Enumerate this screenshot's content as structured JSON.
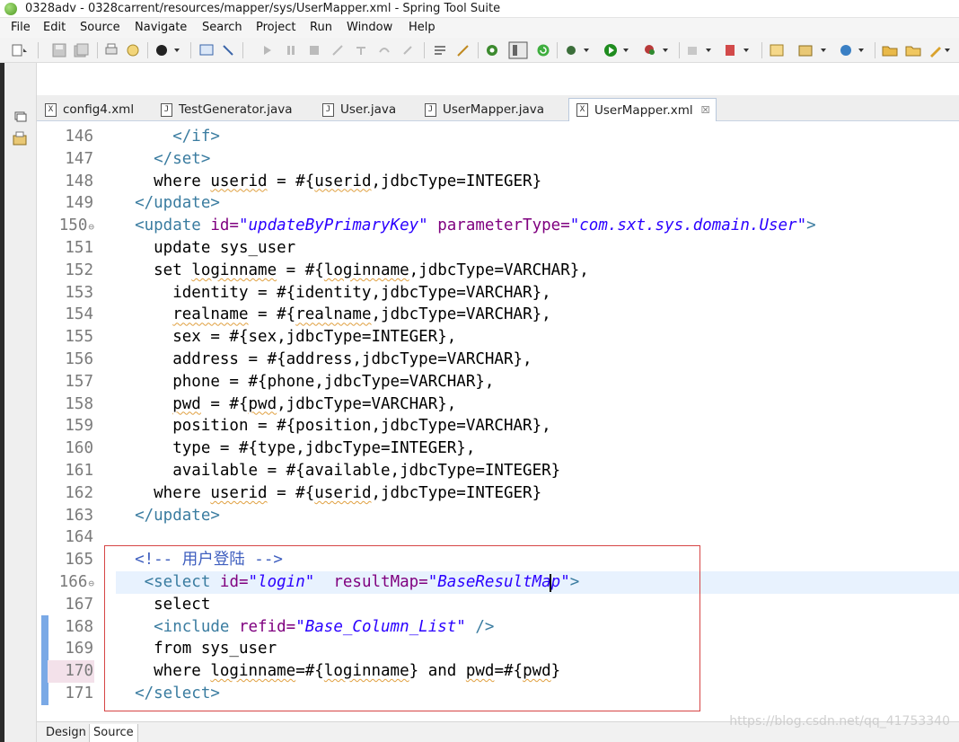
{
  "window": {
    "title": "0328adv - 0328carrent/resources/mapper/sys/UserMapper.xml - Spring Tool Suite"
  },
  "menu": [
    "File",
    "Edit",
    "Source",
    "Navigate",
    "Search",
    "Project",
    "Run",
    "Window",
    "Help"
  ],
  "tabs": [
    {
      "label": "config4.xml",
      "icon": "xml-file-icon",
      "active": false
    },
    {
      "label": "TestGenerator.java",
      "icon": "java-file-icon",
      "active": false
    },
    {
      "label": "User.java",
      "icon": "java-file-icon",
      "active": false
    },
    {
      "label": "UserMapper.java",
      "icon": "java-file-icon",
      "active": false
    },
    {
      "label": "UserMapper.xml",
      "icon": "xml-file-icon",
      "active": true,
      "close": "☒"
    }
  ],
  "editor": {
    "lines": [
      {
        "n": "146",
        "fold": ""
      },
      {
        "n": "147",
        "fold": ""
      },
      {
        "n": "148",
        "fold": ""
      },
      {
        "n": "149",
        "fold": ""
      },
      {
        "n": "150",
        "fold": "⊖"
      },
      {
        "n": "151",
        "fold": ""
      },
      {
        "n": "152",
        "fold": ""
      },
      {
        "n": "153",
        "fold": ""
      },
      {
        "n": "154",
        "fold": ""
      },
      {
        "n": "155",
        "fold": ""
      },
      {
        "n": "156",
        "fold": ""
      },
      {
        "n": "157",
        "fold": ""
      },
      {
        "n": "158",
        "fold": ""
      },
      {
        "n": "159",
        "fold": ""
      },
      {
        "n": "160",
        "fold": ""
      },
      {
        "n": "161",
        "fold": ""
      },
      {
        "n": "162",
        "fold": ""
      },
      {
        "n": "163",
        "fold": ""
      },
      {
        "n": "164",
        "fold": ""
      },
      {
        "n": "165",
        "fold": ""
      },
      {
        "n": "166",
        "fold": "⊖"
      },
      {
        "n": "167",
        "fold": ""
      },
      {
        "n": "168",
        "fold": ""
      },
      {
        "n": "169",
        "fold": ""
      },
      {
        "n": "170",
        "fold": ""
      },
      {
        "n": "171",
        "fold": ""
      }
    ],
    "code": {
      "l146": "      </if>",
      "l147": "    </set>",
      "l148a": "    where ",
      "l148b": "userid",
      "l148c": " = #{",
      "l148d": "userid",
      "l148e": ",jdbcType=INTEGER}",
      "l149": "  </update>",
      "l150_tag": "  <update ",
      "l150_attr1": "id=",
      "l150_val1": "\"updateByPrimaryKey\"",
      "l150_attr2": " parameterType=",
      "l150_val2": "\"com.sxt.sys.domain.User\"",
      "l150_end": ">",
      "l151": "    update sys_user",
      "l152a": "    set ",
      "l152b": "loginname",
      "l152c": " = #{",
      "l152d": "loginname",
      "l152e": ",jdbcType=VARCHAR},",
      "l153": "      identity = #{identity,jdbcType=VARCHAR},",
      "l154a": "      ",
      "l154b": "realname",
      "l154c": " = #{",
      "l154d": "realname",
      "l154e": ",jdbcType=VARCHAR},",
      "l155": "      sex = #{sex,jdbcType=INTEGER},",
      "l156": "      address = #{address,jdbcType=VARCHAR},",
      "l157": "      phone = #{phone,jdbcType=VARCHAR},",
      "l158a": "      ",
      "l158b": "pwd",
      "l158c": " = #{",
      "l158d": "pwd",
      "l158e": ",jdbcType=VARCHAR},",
      "l159": "      position = #{position,jdbcType=VARCHAR},",
      "l160": "      type = #{type,jdbcType=INTEGER},",
      "l161": "      available = #{available,jdbcType=INTEGER}",
      "l162a": "    where ",
      "l162b": "userid",
      "l162c": " = #{",
      "l162d": "userid",
      "l162e": ",jdbcType=INTEGER}",
      "l163": "  </update>",
      "l165": "  <!-- 用户登陆 -->",
      "l166_tag": "   <select ",
      "l166_attr1": "id=",
      "l166_val1": "\"login\"",
      "l166_attr2": "  resultMap=",
      "l166_val2": "\"BaseResultMap\"",
      "l166_end": ">",
      "l167": "    select",
      "l168_tag": "    <include ",
      "l168_attr": "refid=",
      "l168_val": "\"Base_Column_List\"",
      "l168_end": " />",
      "l169": "    from sys_user",
      "l170a": "    where ",
      "l170b": "loginname",
      "l170c": "=#{",
      "l170d": "loginname",
      "l170e": "} and ",
      "l170f": "pwd",
      "l170g": "=#{",
      "l170h": "pwd",
      "l170i": "}",
      "l171": "  </select>"
    }
  },
  "bottom_tabs": {
    "design": "Design",
    "source": "Source"
  },
  "watermark": "https://blog.csdn.net/qq_41753340",
  "colors": {
    "tag": "#3a7ca0",
    "attribute": "#7f007f",
    "string": "#2a00ff",
    "comment": "#3f5fbf",
    "highlight_box": "#d64545"
  }
}
